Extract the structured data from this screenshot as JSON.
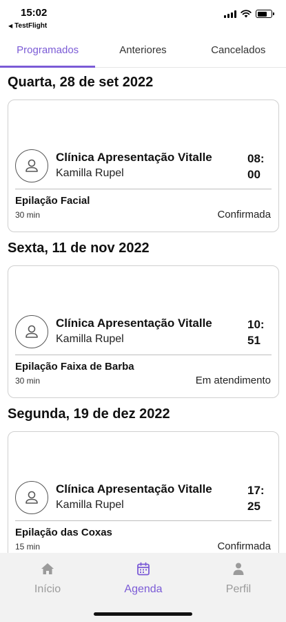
{
  "status_bar": {
    "time": "15:02",
    "back_app": "TestFlight"
  },
  "tabs": [
    {
      "label": "Programados",
      "active": true
    },
    {
      "label": "Anteriores",
      "active": false
    },
    {
      "label": "Cancelados",
      "active": false
    }
  ],
  "days": [
    {
      "heading": "Quarta, 28 de set 2022",
      "appointment": {
        "clinic": "Clínica Apresentação Vitalle",
        "professional": "Kamilla Rupel",
        "time_hour": "08:",
        "time_minute": "00",
        "service": "Epilação Facial",
        "duration": "30 min",
        "status": "Confirmada"
      }
    },
    {
      "heading": "Sexta, 11 de nov 2022",
      "appointment": {
        "clinic": "Clínica Apresentação Vitalle",
        "professional": "Kamilla Rupel",
        "time_hour": "10:",
        "time_minute": "51",
        "service": "Epilação Faixa de Barba",
        "duration": "30 min",
        "status": "Em atendimento"
      }
    },
    {
      "heading": "Segunda, 19 de dez 2022",
      "appointment": {
        "clinic": "Clínica Apresentação Vitalle",
        "professional": "Kamilla Rupel",
        "time_hour": "17:",
        "time_minute": "25",
        "service": "Epilação das Coxas",
        "duration": "15 min",
        "status": "Confirmada"
      }
    }
  ],
  "bottom_nav": [
    {
      "label": "Início",
      "icon": "home-icon",
      "active": false
    },
    {
      "label": "Agenda",
      "icon": "calendar-icon",
      "active": true
    },
    {
      "label": "Perfil",
      "icon": "person-icon",
      "active": false
    }
  ],
  "colors": {
    "accent": "#7b5bd6",
    "inactive": "#9b9b9b",
    "nav_bg": "#f2f2f2"
  }
}
